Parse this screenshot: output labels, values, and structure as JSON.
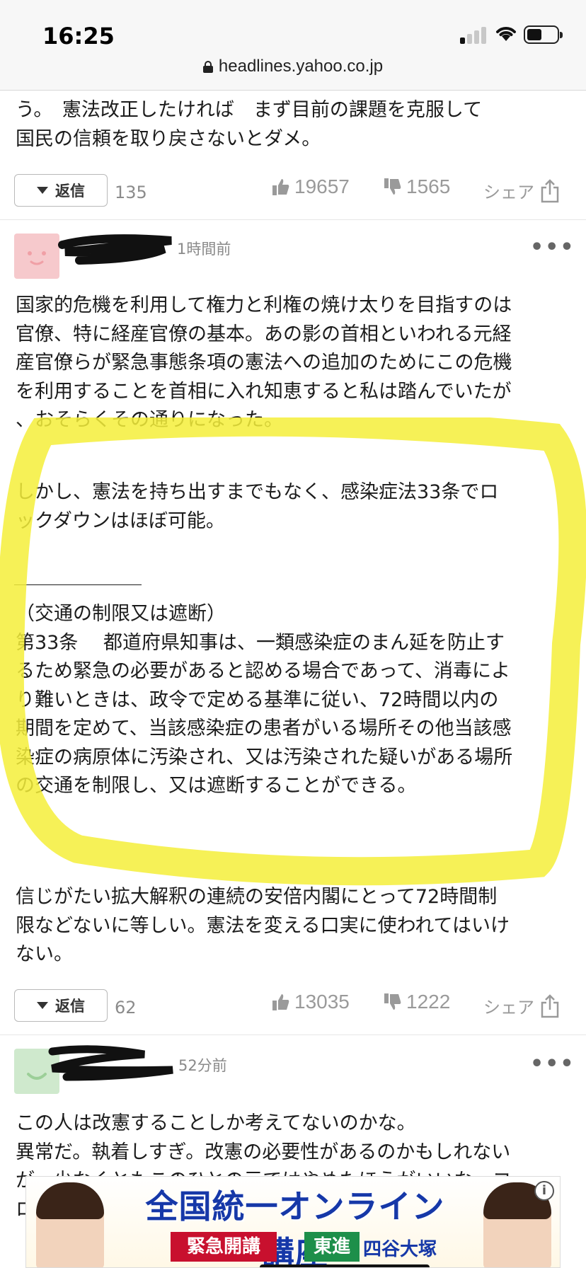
{
  "status_bar": {
    "time": "16:25"
  },
  "url_bar": {
    "domain": "headlines.yahoo.co.jp"
  },
  "comment1": {
    "lines": [
      "う。　憲法改正したければ　まず目前の課題を克服して",
      "国民の信頼を取り戻さないとダメ。"
    ],
    "reply_label": "返信",
    "reply_count": "135",
    "likes": "19657",
    "dislikes": "1565",
    "share_label": "シェア"
  },
  "comment2": {
    "time": "1時間前",
    "para1": [
      "国家的危機を利用して権力と利権の焼け太りを目指すのは",
      "官僚、特に経産官僚の基本。あの影の首相といわれる元経",
      "産官僚らが緊急事態条項の憲法への追加のためにこの危機",
      "を利用することを首相に入れ知恵すると私は踏んでいたが",
      "、おそらくその通りになった。"
    ],
    "para2": [
      "しかし、憲法を持ち出すまでもなく、感染症法33条でロ",
      "ックダウンはほぼ可能。"
    ],
    "para3": [
      "（交通の制限又は遮断）",
      "第33条　 都道府県知事は、一類感染症のまん延を防止す",
      "るため緊急の必要があると認める場合であって、消毒によ",
      "り難いときは、政令で定める基準に従い、72時間以内の",
      "期間を定めて、当該感染症の患者がいる場所その他当該感",
      "染症の病原体に汚染され、又は汚染された疑いがある場所",
      "の交通を制限し、又は遮断することができる。"
    ],
    "para4": [
      "信じがたい拡大解釈の連続の安倍内閣にとって72時間制",
      "限などないに等しい。憲法を変える口実に使われてはいけ",
      "ない。"
    ],
    "reply_label": "返信",
    "reply_count": "62",
    "likes": "13035",
    "dislikes": "1222",
    "share_label": "シェア"
  },
  "comment3": {
    "time": "52分前",
    "lines": [
      "この人は改憲することしか考えてないのかな。",
      "異常だ。執着しすぎ。改憲の必要性があるのかもしれない",
      "が、少なくともこのひとの元ではやめたほうがいいな。コ",
      "ロ"
    ]
  },
  "ad": {
    "title": "全国統一オンライン講座",
    "badge_red": "緊急開講",
    "badge_green": "東進",
    "brand": "四谷大塚"
  },
  "colors": {
    "highlight": "#f4ee3a",
    "avatar_pink": "#f6c9cc",
    "avatar_green": "#cfe9cd",
    "ad_blue": "#1638a8"
  },
  "icons": [
    "lock-icon",
    "signal-icon",
    "wifi-icon",
    "battery-icon",
    "thumbs-up-icon",
    "thumbs-down-icon",
    "share-icon",
    "more-icon",
    "dropdown-triangle-icon",
    "ad-info-icon"
  ]
}
